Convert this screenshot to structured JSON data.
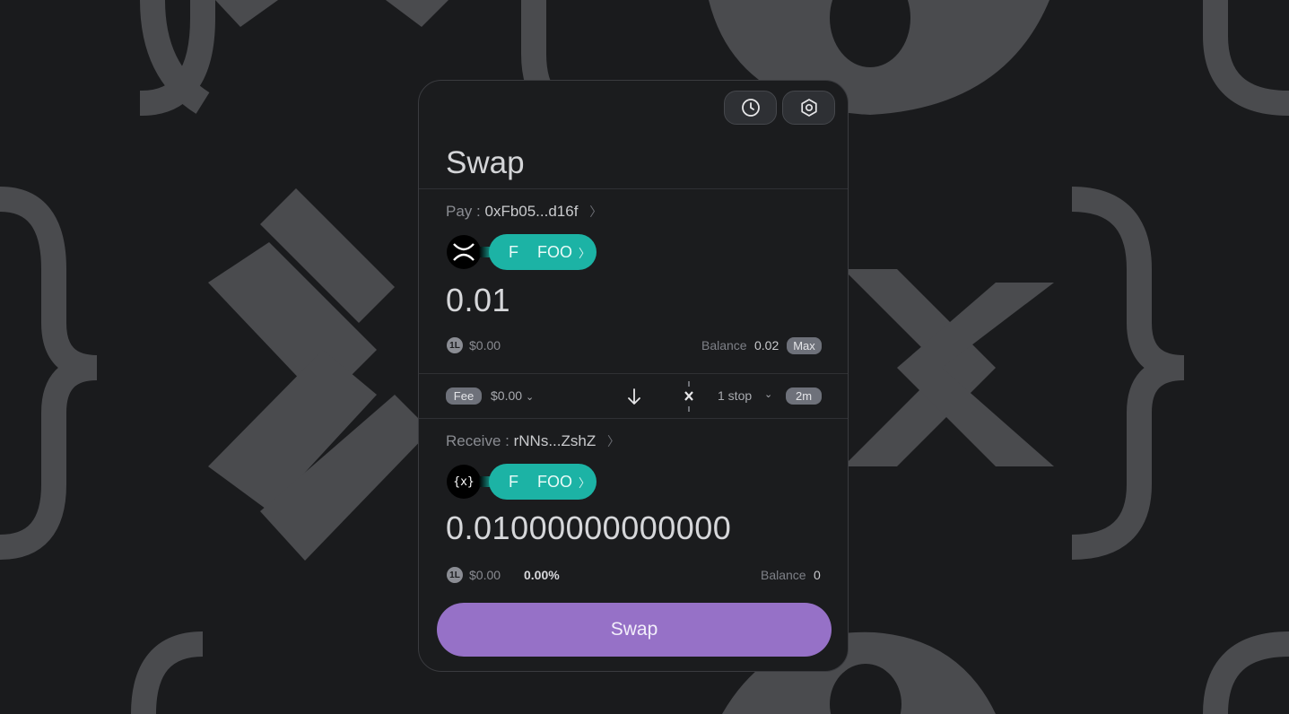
{
  "header": {
    "title": "Swap",
    "history_icon": "clock-icon",
    "settings_icon": "gear-icon"
  },
  "pay": {
    "label": "Pay :",
    "address": "0xFb05...d16f",
    "address_chevron": "〉",
    "chain_logo": "xrp-x-logo",
    "token_symbol": "F",
    "token_name": "FOO",
    "token_chevron": "〉",
    "amount": "0.01",
    "usd_icon": "1L",
    "usd_value": "$0.00",
    "balance_label": "Balance",
    "balance_value": "0.02",
    "max_label": "Max"
  },
  "route": {
    "fee_label": "Fee",
    "fee_value": "$0.00",
    "fee_chevron": "⌄",
    "direction_icon": "arrow-down-icon",
    "route_icon": "route-x-icon",
    "stops": "1 stop",
    "stops_chevron": "⌄",
    "time": "2m"
  },
  "receive": {
    "label": "Receive :",
    "address": "rNNs...ZshZ",
    "address_chevron": "〉",
    "chain_logo": "{x}",
    "token_symbol": "F",
    "token_name": "FOO",
    "token_chevron": "〉",
    "amount": "0.01000000000000",
    "usd_icon": "1L",
    "usd_value": "$0.00",
    "price_impact": "0.00%",
    "balance_label": "Balance",
    "balance_value": "0"
  },
  "action": {
    "swap_label": "Swap"
  },
  "colors": {
    "accent": "#9671c7",
    "token": "#1cb3a5",
    "background": "#1a1b1d",
    "card": "#1b1c1e"
  }
}
